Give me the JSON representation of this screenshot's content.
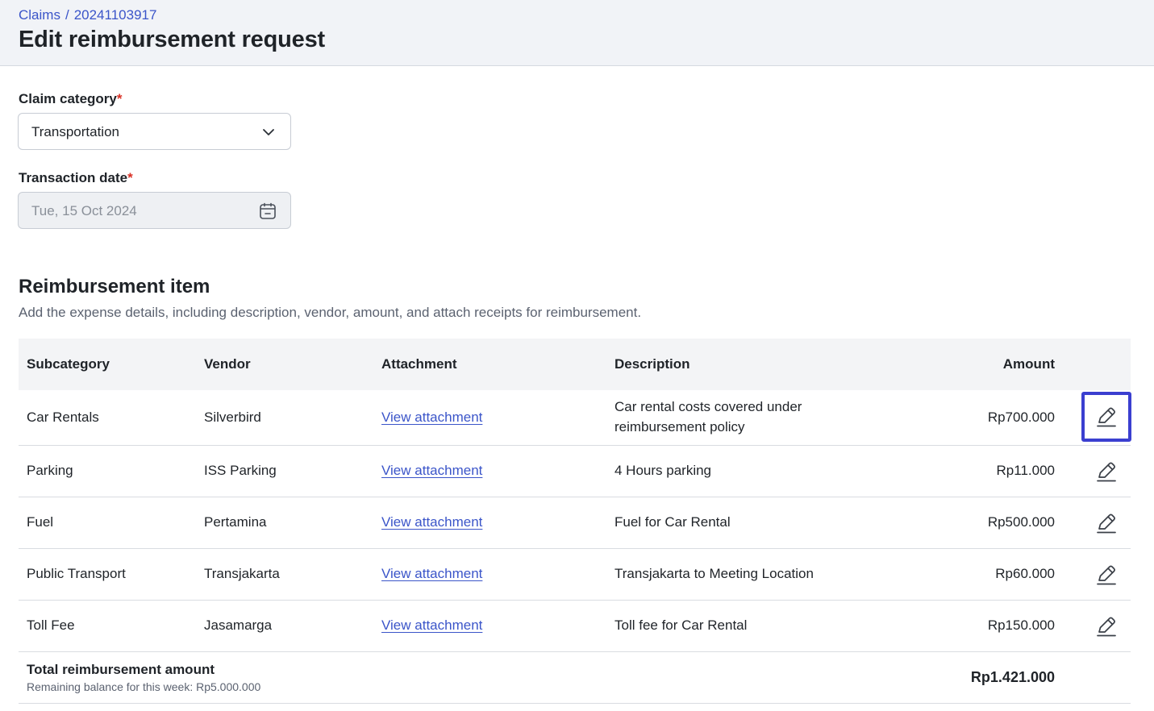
{
  "header": {
    "breadcrumb_root": "Claims",
    "breadcrumb_separator": "/",
    "breadcrumb_current": "20241103917",
    "title": "Edit reimbursement request"
  },
  "form": {
    "category_label": "Claim category",
    "category_value": "Transportation",
    "date_label": "Transaction date",
    "date_value": "Tue, 15 Oct 2024",
    "required_mark": "*"
  },
  "section": {
    "title": "Reimbursement item",
    "description": "Add the expense details, including description, vendor, amount, and attach receipts for reimbursement."
  },
  "table": {
    "columns": {
      "subcategory": "Subcategory",
      "vendor": "Vendor",
      "attachment": "Attachment",
      "description": "Description",
      "amount": "Amount"
    },
    "rows": [
      {
        "subcategory": "Car Rentals",
        "vendor": "Silverbird",
        "attachment": "View attachment",
        "description_line1": "Car rental costs covered under",
        "description_line2": "reimbursement policy",
        "amount": "Rp700.000"
      },
      {
        "subcategory": "Parking",
        "vendor": "ISS Parking",
        "attachment": "View attachment",
        "description": "4 Hours parking",
        "amount": "Rp11.000"
      },
      {
        "subcategory": "Fuel",
        "vendor": "Pertamina",
        "attachment": "View attachment",
        "description": "Fuel for Car Rental",
        "amount": "Rp500.000"
      },
      {
        "subcategory": "Public Transport",
        "vendor": "Transjakarta",
        "attachment": "View attachment",
        "description": "Transjakarta to Meeting Location",
        "amount": "Rp60.000"
      },
      {
        "subcategory": "Toll Fee",
        "vendor": "Jasamarga",
        "attachment": "View attachment",
        "description": "Toll fee for Car Rental",
        "amount": "Rp150.000"
      }
    ],
    "total_label": "Total reimbursement amount",
    "remaining_balance": "Remaining balance for this week: Rp5.000.000",
    "total_amount": "Rp1.421.000"
  },
  "icons": {
    "category_dropdown": "chevron-down-icon",
    "date_picker": "calendar-icon",
    "row_action": "pencil-icon"
  },
  "colors": {
    "accent": "#3b55c9",
    "focus": "#3b3fd0",
    "required": "#d93025",
    "header_bg": "#f1f3f7"
  }
}
